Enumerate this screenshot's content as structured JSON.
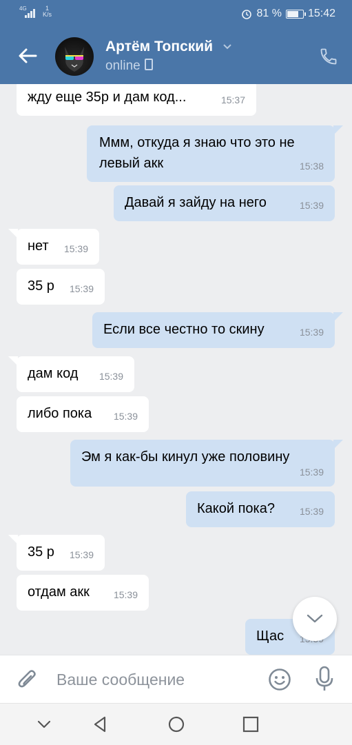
{
  "status_bar": {
    "network": "4G",
    "speed_value": "1",
    "speed_unit": "K/s",
    "battery": "81 %",
    "battery_level": 0.81,
    "time": "15:42"
  },
  "header": {
    "name": "Артём Топский",
    "status": "online",
    "icons": [
      "back-arrow-icon",
      "chevron-down-icon",
      "mobile-icon",
      "phone-icon"
    ]
  },
  "messages": [
    {
      "dir": "in",
      "text": "жду еще 35р и дам код...",
      "time": "15:37"
    },
    {
      "dir": "out",
      "text": "Ммм, откуда я знаю что это не левый акк",
      "time": "15:38"
    },
    {
      "dir": "out",
      "text": "Давай я зайду на него",
      "time": "15:39"
    },
    {
      "dir": "in",
      "text": "нет",
      "time": "15:39"
    },
    {
      "dir": "in",
      "text": "35 р",
      "time": "15:39"
    },
    {
      "dir": "out",
      "text": "Если все честно то скину",
      "time": "15:39"
    },
    {
      "dir": "in",
      "text": "дам код",
      "time": "15:39"
    },
    {
      "dir": "in",
      "text": "либо пока",
      "time": "15:39"
    },
    {
      "dir": "out",
      "text": "Эм я как-бы кинул уже половину",
      "time": "15:39"
    },
    {
      "dir": "out",
      "text": "Какой пока?",
      "time": "15:39"
    },
    {
      "dir": "in",
      "text": "35 р",
      "time": "15:39"
    },
    {
      "dir": "in",
      "text": "отдам акк",
      "time": "15:39"
    },
    {
      "dir": "out",
      "text": "Щас",
      "time": "15:39"
    }
  ],
  "composer": {
    "placeholder": "Ваше сообщение",
    "icons": [
      "paperclip-icon",
      "smile-icon",
      "microphone-icon"
    ]
  },
  "colors": {
    "header": "#4a76a8",
    "chat_background": "#edeef0",
    "incoming_bubble": "#ffffff",
    "outgoing_bubble": "#cfe0f3"
  }
}
